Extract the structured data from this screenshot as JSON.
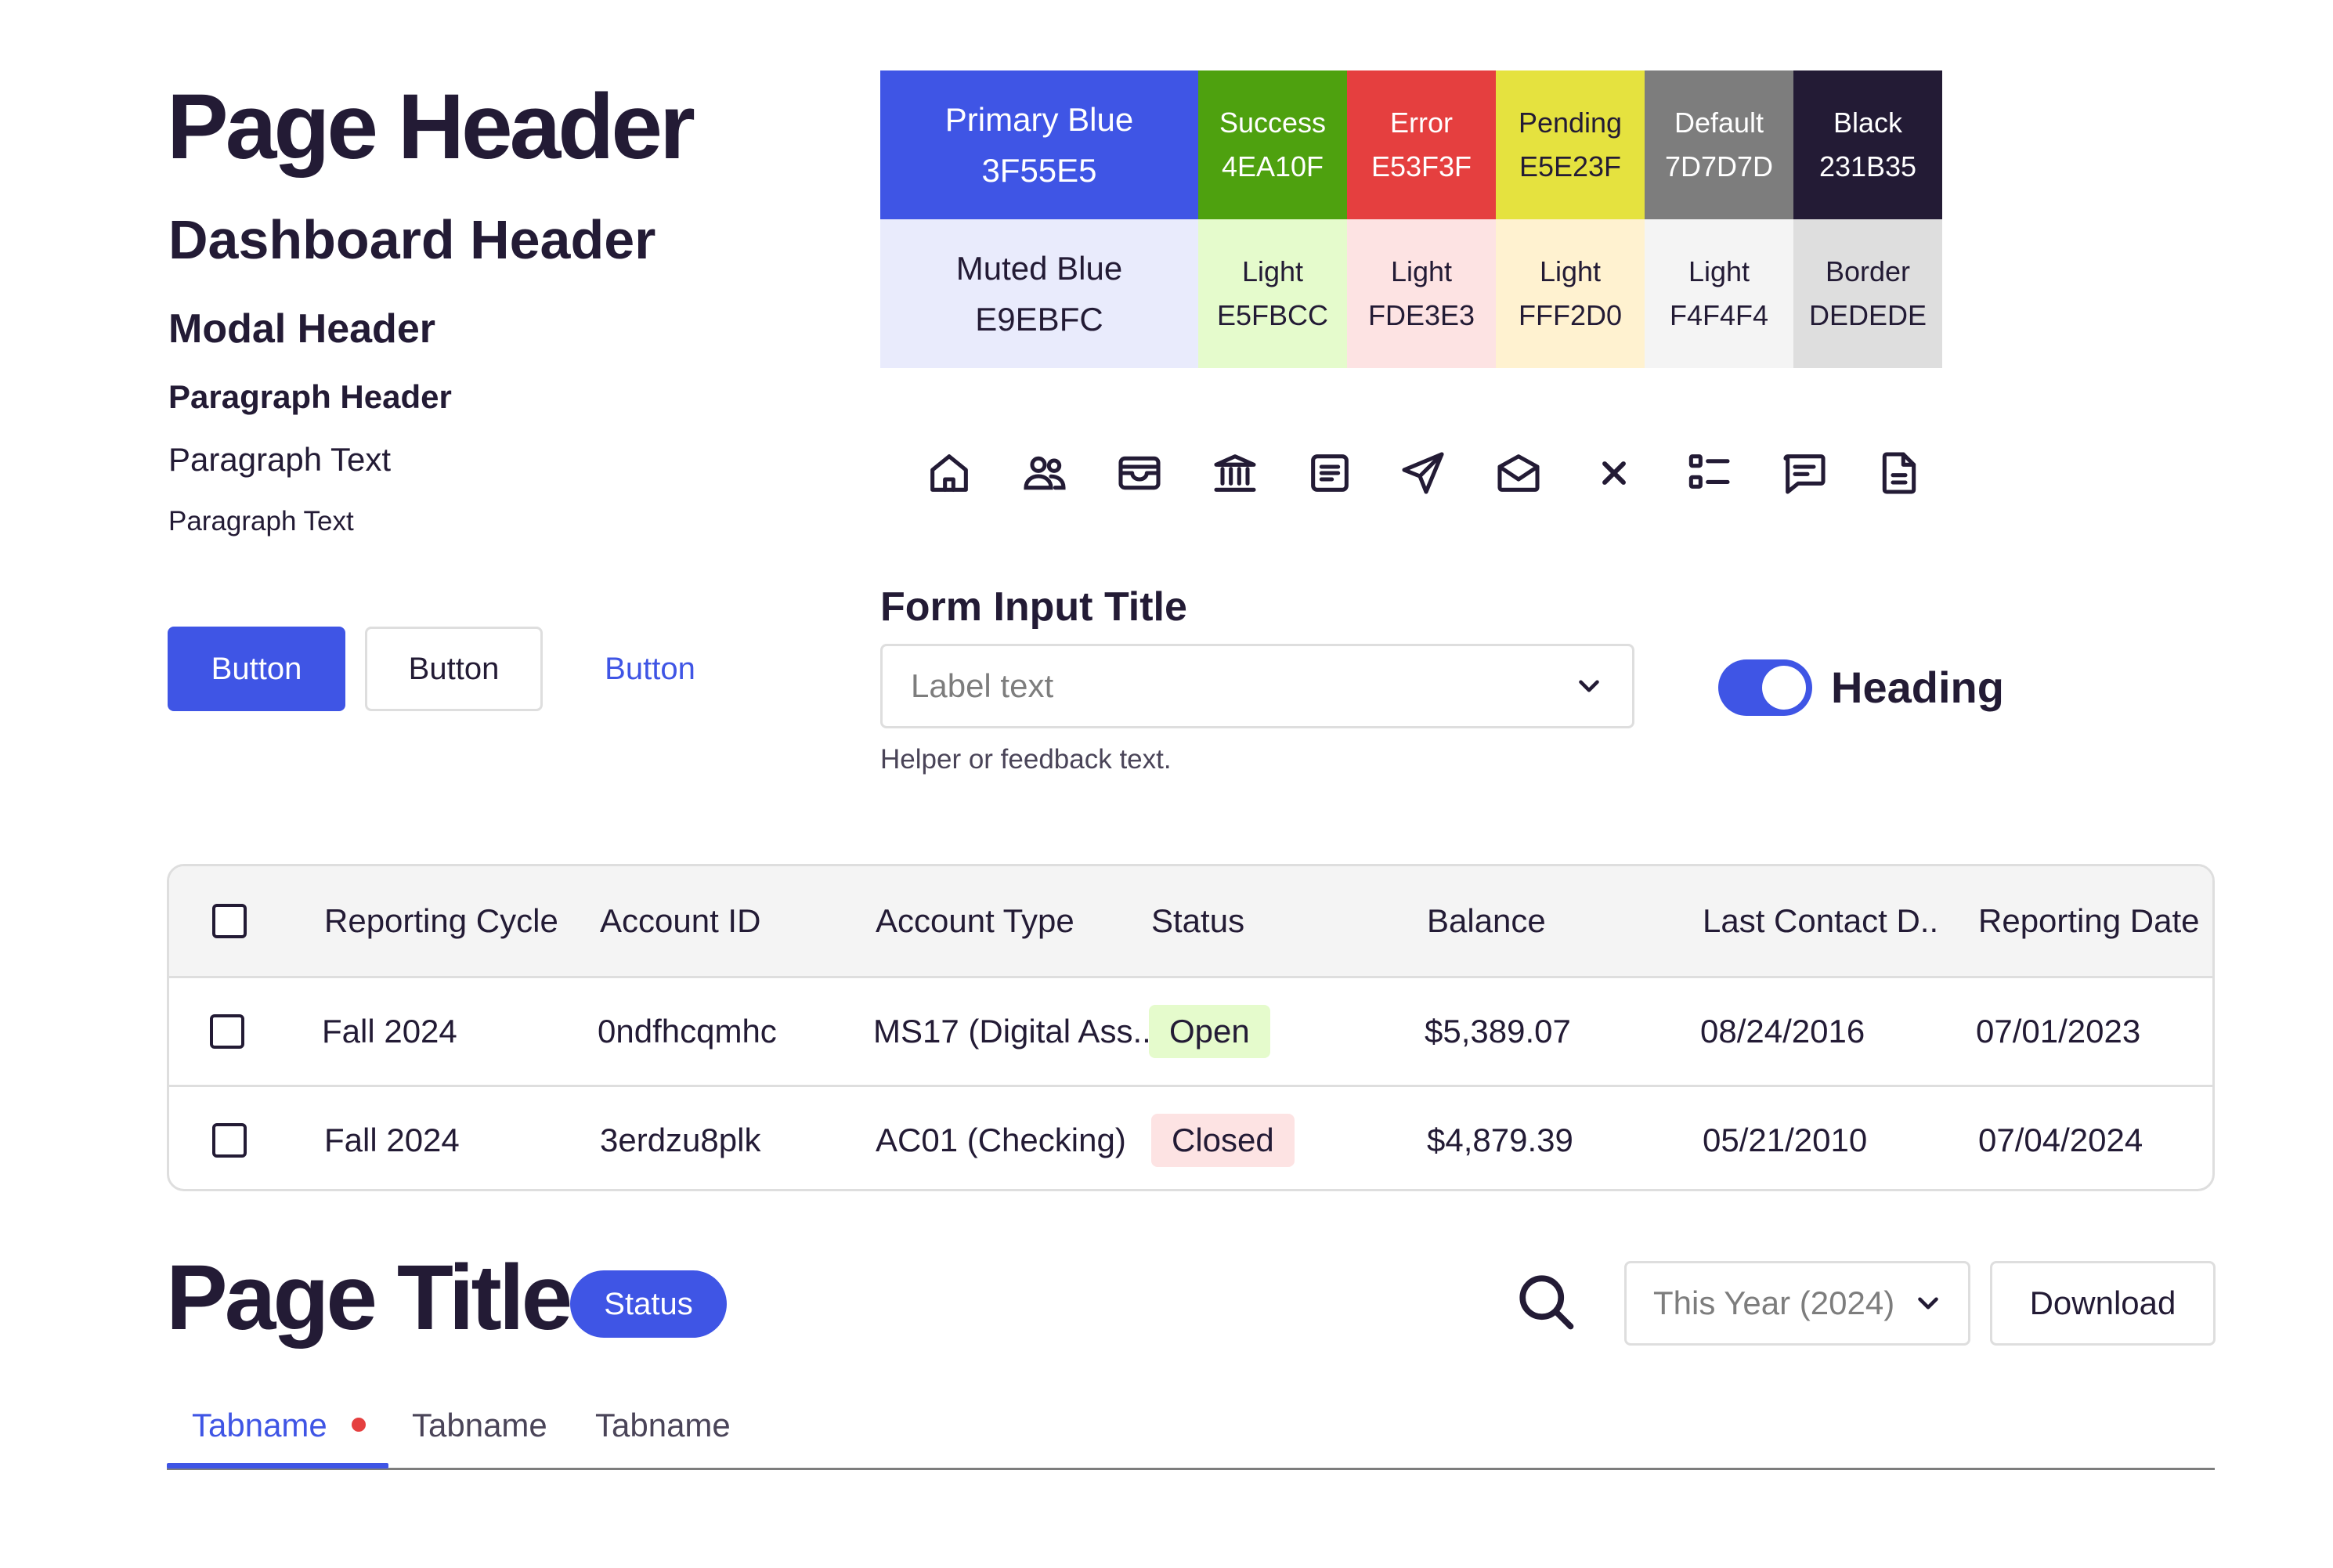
{
  "typography": {
    "page_header": "Page Header",
    "dashboard_header": "Dashboard Header",
    "modal_header": "Modal Header",
    "paragraph_header": "Paragraph Header",
    "paragraph_text": "Paragraph Text",
    "paragraph_text_small": "Paragraph Text"
  },
  "buttons": {
    "primary": "Button",
    "outline": "Button",
    "link": "Button"
  },
  "palette": [
    {
      "name": "Primary Blue",
      "hex": "3F55E5",
      "color": "#3F55E5",
      "text_color": "#FFFFFF"
    },
    {
      "name": "Success",
      "hex": "4EA10F",
      "color": "#4EA10F",
      "text_color": "#FFFFFF"
    },
    {
      "name": "Error",
      "hex": "E53F3F",
      "color": "#E53F3F",
      "text_color": "#FFFFFF"
    },
    {
      "name": "Pending",
      "hex": "E5E23F",
      "color": "#E5E23F",
      "text_color": "#231B35"
    },
    {
      "name": "Default",
      "hex": "7D7D7D",
      "color": "#7D7D7D",
      "text_color": "#FFFFFF"
    },
    {
      "name": "Black",
      "hex": "231B35",
      "color": "#231B35",
      "text_color": "#FFFFFF"
    },
    {
      "name": "Muted Blue",
      "hex": "E9EBFC",
      "color": "#E9EBFC",
      "text_color": "#231B35"
    },
    {
      "name": "Light",
      "hex": "E5FBCC",
      "color": "#E5FBCC",
      "text_color": "#231B35"
    },
    {
      "name": "Light",
      "hex": "FDE3E3",
      "color": "#FDE3E3",
      "text_color": "#231B35"
    },
    {
      "name": "Light",
      "hex": "FFF2D0",
      "color": "#FFF2D0",
      "text_color": "#231B35"
    },
    {
      "name": "Light",
      "hex": "F4F4F4",
      "color": "#F4F4F4",
      "text_color": "#231B35"
    },
    {
      "name": "Border",
      "hex": "DEDEDE",
      "color": "#DEDEDE",
      "text_color": "#231B35"
    }
  ],
  "icons": [
    "home-icon",
    "users-icon",
    "wallet-icon",
    "bank-icon",
    "note-icon",
    "send-icon",
    "mail-open-icon",
    "close-icon",
    "list-icon",
    "chat-icon",
    "document-icon"
  ],
  "form": {
    "title": "Form Input Title",
    "placeholder": "Label text",
    "helper": "Helper or feedback text."
  },
  "toggle": {
    "label": "Heading",
    "on": true
  },
  "table": {
    "headers": [
      "Reporting Cycle",
      "Account ID",
      "Account Type",
      "Status",
      "Balance",
      "Last Contact D..",
      "Reporting Date"
    ],
    "rows": [
      {
        "cycle": "Fall 2024",
        "account_id": "0ndfhcqmhc",
        "type": "MS17 (Digital Ass..",
        "status": "Open",
        "balance": "$5,389.07",
        "last_contact": "08/24/2016",
        "reporting_date": "07/01/2023"
      },
      {
        "cycle": "Fall 2024",
        "account_id": "3erdzu8plk",
        "type": "AC01 (Checking)",
        "status": "Closed",
        "balance": "$4,879.39",
        "last_contact": "05/21/2010",
        "reporting_date": "07/04/2024"
      }
    ]
  },
  "page": {
    "title": "Page Title",
    "status": "Status",
    "year_select": "This Year (2024)",
    "download": "Download"
  },
  "tabs": [
    {
      "label": "Tabname",
      "active": true,
      "notification": true
    },
    {
      "label": "Tabname",
      "active": false
    },
    {
      "label": "Tabname",
      "active": false
    }
  ]
}
